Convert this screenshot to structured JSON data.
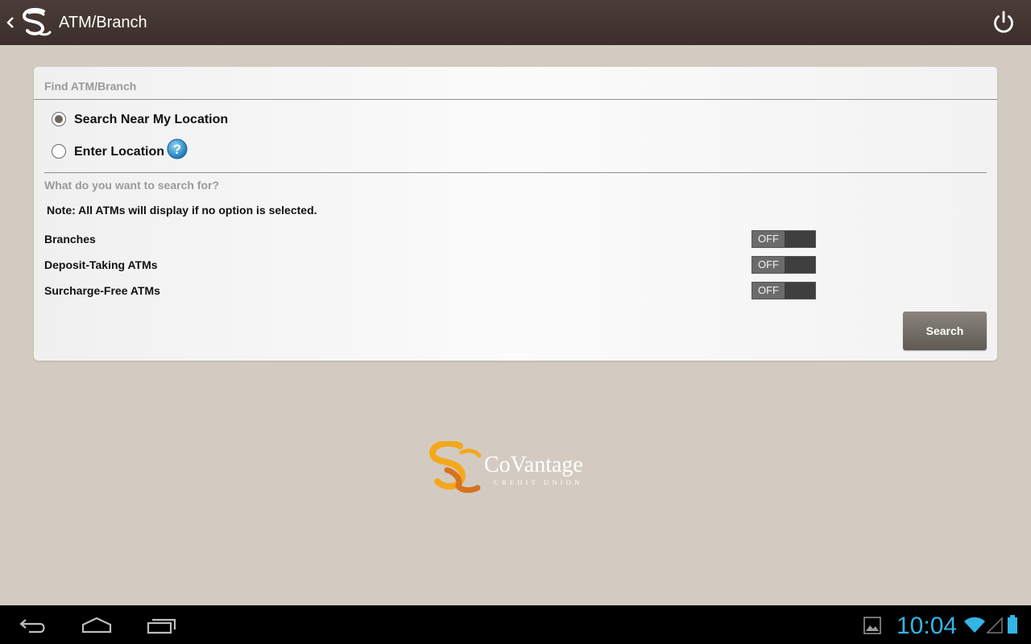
{
  "action_bar": {
    "title": "ATM/Branch"
  },
  "card": {
    "find_title": "Find ATM/Branch",
    "radio_options": [
      {
        "label": "Search Near My Location",
        "checked": true
      },
      {
        "label": "Enter Location",
        "checked": false
      }
    ],
    "search_for_title": "What do you want to search for?",
    "note": "Note: All ATMs will display if no option is selected.",
    "filters": [
      {
        "label": "Branches",
        "state": "OFF"
      },
      {
        "label": "Deposit-Taking ATMs",
        "state": "OFF"
      },
      {
        "label": "Surcharge-Free ATMs",
        "state": "OFF"
      }
    ],
    "search_button": "Search"
  },
  "brand": {
    "name": "CoVantage",
    "tagline": "CREDIT UNION"
  },
  "system_bar": {
    "clock": "10:04",
    "accent_color": "#33b5e5"
  },
  "icons": {
    "back": "chevron-left-icon",
    "logo": "covantage-logo-icon",
    "power": "power-icon",
    "help": "help-question-icon",
    "nav_back": "nav-back-icon",
    "nav_home": "nav-home-icon",
    "nav_recents": "nav-recents-icon",
    "gallery": "gallery-icon",
    "wifi": "wifi-icon",
    "signal": "signal-icon",
    "battery": "battery-icon"
  }
}
